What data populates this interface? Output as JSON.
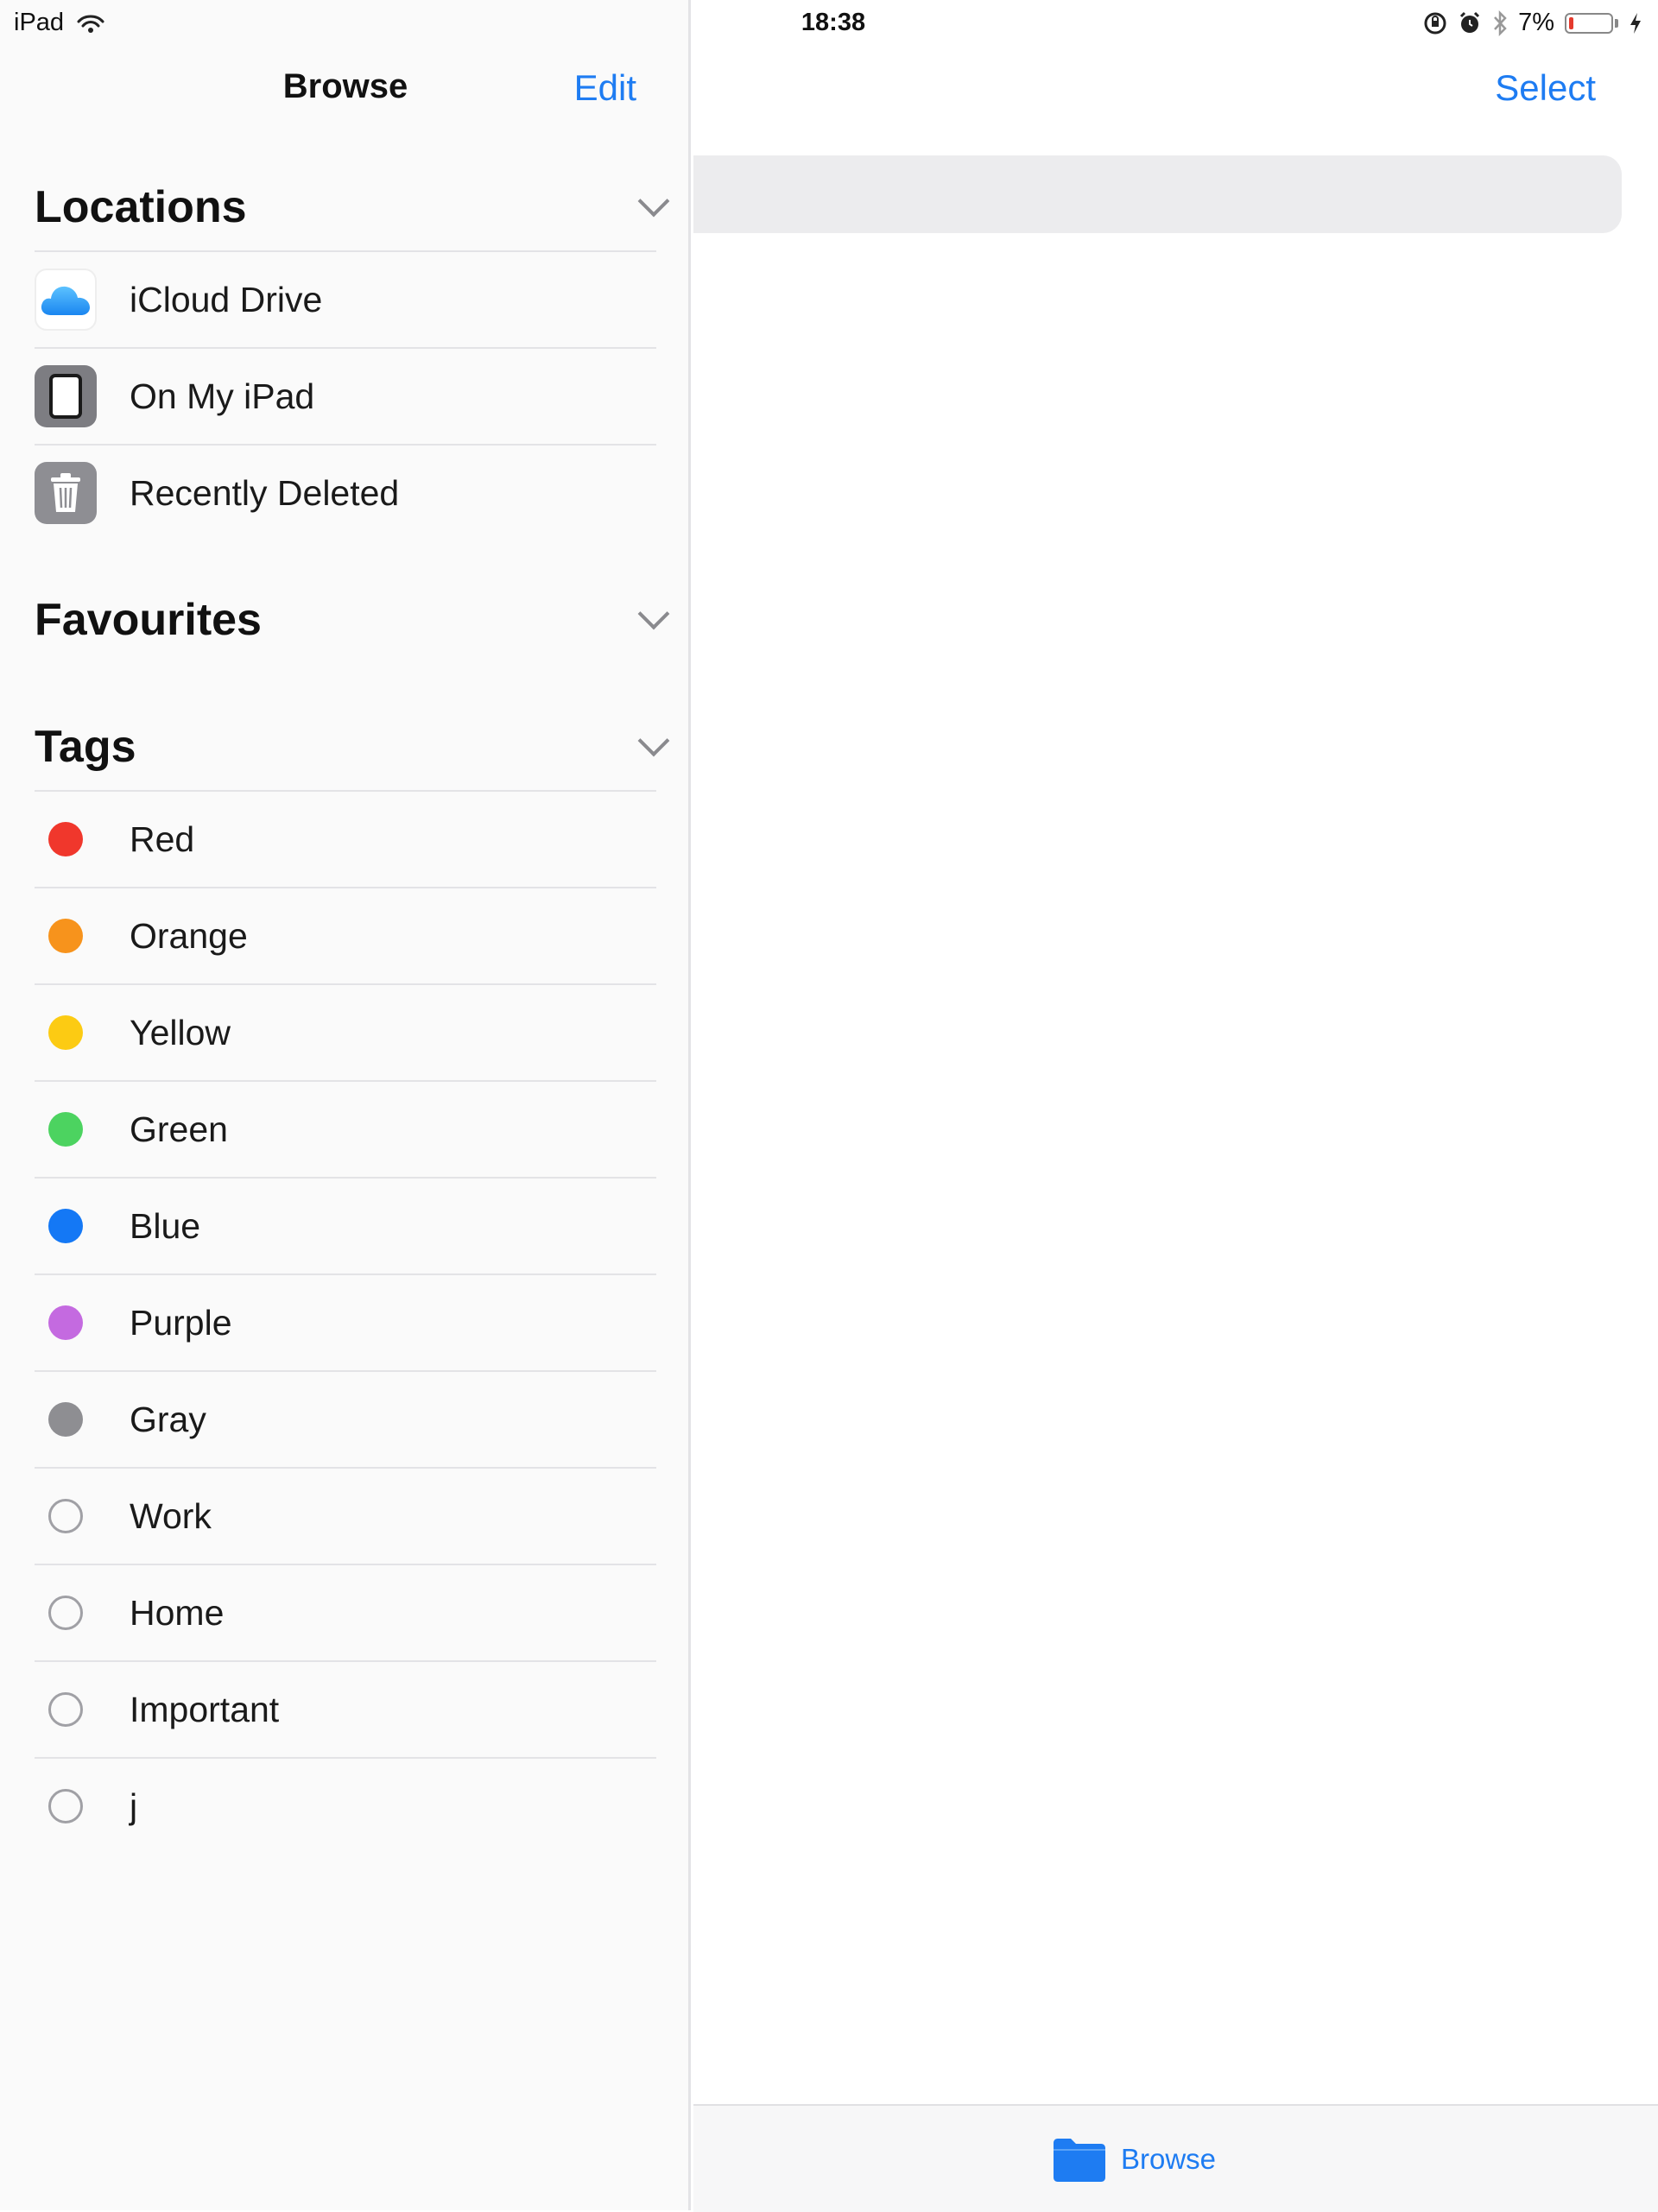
{
  "status_bar": {
    "device": "iPad",
    "time": "18:38",
    "battery_percent": "7%",
    "battery_level": 0.07,
    "icons": [
      "wifi-icon",
      "orientation-lock-icon",
      "alarm-icon",
      "bluetooth-icon",
      "battery-icon",
      "charging-icon"
    ]
  },
  "sidebar": {
    "title": "Browse",
    "edit_label": "Edit",
    "sections": {
      "locations": {
        "title": "Locations",
        "items": [
          {
            "label": "iCloud Drive",
            "icon": "icloud-icon"
          },
          {
            "label": "On My iPad",
            "icon": "ipad-icon"
          },
          {
            "label": "Recently Deleted",
            "icon": "trash-icon"
          }
        ]
      },
      "favourites": {
        "title": "Favourites"
      },
      "tags": {
        "title": "Tags",
        "items": [
          {
            "label": "Red",
            "color": "#f0372c"
          },
          {
            "label": "Orange",
            "color": "#f7931c"
          },
          {
            "label": "Yellow",
            "color": "#fccb13"
          },
          {
            "label": "Green",
            "color": "#4cd360"
          },
          {
            "label": "Blue",
            "color": "#1478f5"
          },
          {
            "label": "Purple",
            "color": "#c46ae0"
          },
          {
            "label": "Gray",
            "color": "#8e8e92"
          },
          {
            "label": "Work",
            "color": ""
          },
          {
            "label": "Home",
            "color": ""
          },
          {
            "label": "Important",
            "color": ""
          },
          {
            "label": "j",
            "color": ""
          }
        ]
      }
    }
  },
  "main": {
    "select_label": "Select"
  },
  "tab_bar": {
    "browse_label": "Browse",
    "icon": "folder-icon"
  },
  "colors": {
    "accent": "#1e7cf2",
    "battery_low": "#e53a2d"
  }
}
